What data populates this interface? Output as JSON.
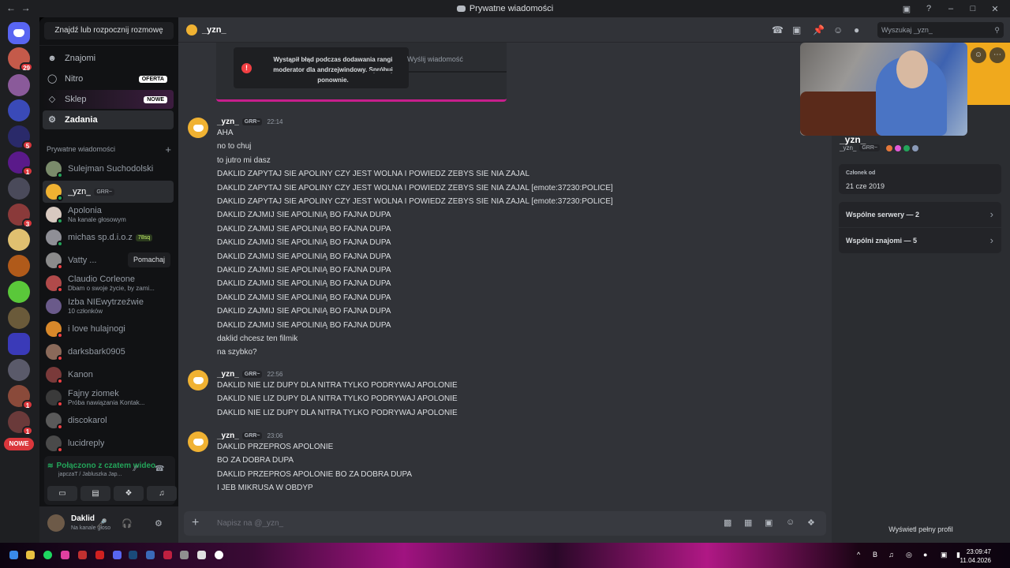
{
  "window": {
    "title": "Prywatne wiadomości"
  },
  "sidebar": {
    "find_label": "Znajdź lub rozpocznij rozmowę",
    "nav": [
      {
        "label": "Znajomi",
        "icon": "friends-icon"
      },
      {
        "label": "Nitro",
        "icon": "nitro-icon",
        "tag": "OFERTA"
      },
      {
        "label": "Sklep",
        "icon": "shop-icon",
        "tag": "NOWE"
      },
      {
        "label": "Zadania",
        "icon": "quests-icon"
      }
    ],
    "dm_heading": "Prywatne wiadomości",
    "dms": [
      {
        "name": "Sulejman Suchodolski",
        "sub": "",
        "color": "#7a8b6b"
      },
      {
        "name": "_yzn_",
        "pill": "GRR~",
        "sub": "",
        "color": "#f0b232",
        "selected": true
      },
      {
        "name": "Apolonia",
        "sub": "Na kanale głosowym",
        "color": "#d8c9c0"
      },
      {
        "name": "michas sp.d.i.o.z",
        "gpill": "78sq",
        "sub": "",
        "color": "#8f8f96"
      },
      {
        "name": "Vatty ...",
        "sub": "",
        "color": "#8b8b8b",
        "action": "Pomachaj"
      },
      {
        "name": "Claudio Corleone",
        "sub": "Dbam o swoje życie, by zami...",
        "color": "#b04a4a"
      },
      {
        "name": "Izba NIEwytrzeźwie",
        "sub": "10 członków",
        "color": "#6a5a8a"
      },
      {
        "name": "i love hulajnogi",
        "sub": "",
        "color": "#d8882a"
      },
      {
        "name": "darksbark0905",
        "sub": "",
        "color": "#8a6a5a"
      },
      {
        "name": "Kanon",
        "sub": "",
        "color": "#7a3a3a"
      },
      {
        "name": "Fajny ziomek",
        "sub": "Próba nawiązania Kontak...",
        "color": "#3a3a3a"
      },
      {
        "name": "discokarol",
        "sub": "",
        "color": "#5a5a5a"
      },
      {
        "name": "lucidreply",
        "sub": "",
        "color": "#4a4a4a"
      }
    ],
    "new_badge": "NOWE"
  },
  "voice": {
    "title": "Połączono z czatem wideo",
    "sub": "japczaT / Jabluszka Jap..."
  },
  "user": {
    "name": "Daklid",
    "status": "Na kanale głoso"
  },
  "header": {
    "name": "_yzn_",
    "search_placeholder": "Wyszukaj _yzn_"
  },
  "embed": {
    "error": "Wystąpił błąd podczas dodawania rangi moderator dla andrzejwindowy. Spróbuj ponownie.",
    "send_label": "Wyślij wiadomość"
  },
  "messages": [
    {
      "author": "_yzn_",
      "tag": "GRR~",
      "time": "22:14",
      "lines": [
        "AHA",
        "no to chuj",
        "to jutro mi dasz",
        "DAKLID ZAPYTAJ SIE APOLINY CZY JEST WOLNA I POWIEDZ ZEBYS SIE NIA ZAJAL",
        "DAKLID ZAPYTAJ SIE APOLINY CZY JEST WOLNA I POWIEDZ ZEBYS SIE NIA ZAJAL [emote:37230:POLICE]",
        "DAKLID ZAPYTAJ SIE APOLINY CZY JEST WOLNA I POWIEDZ ZEBYS SIE NIA ZAJAL [emote:37230:POLICE]",
        "DAKLID ZAJMIJ SIE APOLINIĄ BO FAJNA DUPA",
        "DAKLID ZAJMIJ SIE APOLINIĄ BO FAJNA DUPA",
        "DAKLID ZAJMIJ SIE APOLINIĄ BO FAJNA DUPA",
        "DAKLID ZAJMIJ SIE APOLINIĄ BO FAJNA DUPA",
        "DAKLID ZAJMIJ SIE APOLINIĄ BO FAJNA DUPA",
        "DAKLID ZAJMIJ SIE APOLINIĄ BO FAJNA DUPA",
        "DAKLID ZAJMIJ SIE APOLINIĄ BO FAJNA DUPA",
        "DAKLID ZAJMIJ SIE APOLINIĄ BO FAJNA DUPA",
        "DAKLID ZAJMIJ SIE APOLINIĄ BO FAJNA DUPA",
        "daklid chcesz ten filmik",
        "na szybko?"
      ]
    },
    {
      "author": "_yzn_",
      "tag": "GRR~",
      "time": "22:56",
      "lines": [
        "DAKLID NIE LIZ DUPY DLA NITRA TYLKO PODRYWAJ APOLONIE",
        "DAKLID NIE LIZ DUPY DLA NITRA TYLKO PODRYWAJ APOLONIE",
        "DAKLID NIE LIZ DUPY DLA NITRA TYLKO PODRYWAJ APOLONIE"
      ]
    },
    {
      "author": "_yzn_",
      "tag": "GRR~",
      "time": "23:06",
      "lines": [
        "DAKLID PRZEPROS APOLONIE",
        "BO ZA DOBRA DUPA",
        "DAKLID PRZEPROS APOLONIE BO ZA DOBRA DUPA",
        "I JEB MIKRUSA W OBDYP"
      ]
    }
  ],
  "composer": {
    "placeholder": "Napisz na @_yzn_"
  },
  "profile": {
    "name": "_yzn_",
    "sub": "_yzn_",
    "tag": "GRR~",
    "member_since_label": "Członek od",
    "member_since": "21 cze 2019",
    "mutual_servers": "Wspólne serwery — 2",
    "mutual_friends": "Wspólni znajomi — 5",
    "full_profile": "Wyświetl pełny profil"
  },
  "taskbar": {
    "time": "23:09:47",
    "date": "11.04.2026"
  },
  "rail_badges": [
    "29",
    "5",
    "1",
    "3",
    "1",
    "1"
  ],
  "colors": {
    "accent": "#5865f2",
    "online": "#23a55a",
    "danger": "#da373c",
    "avatar_yellow": "#f0b232"
  }
}
